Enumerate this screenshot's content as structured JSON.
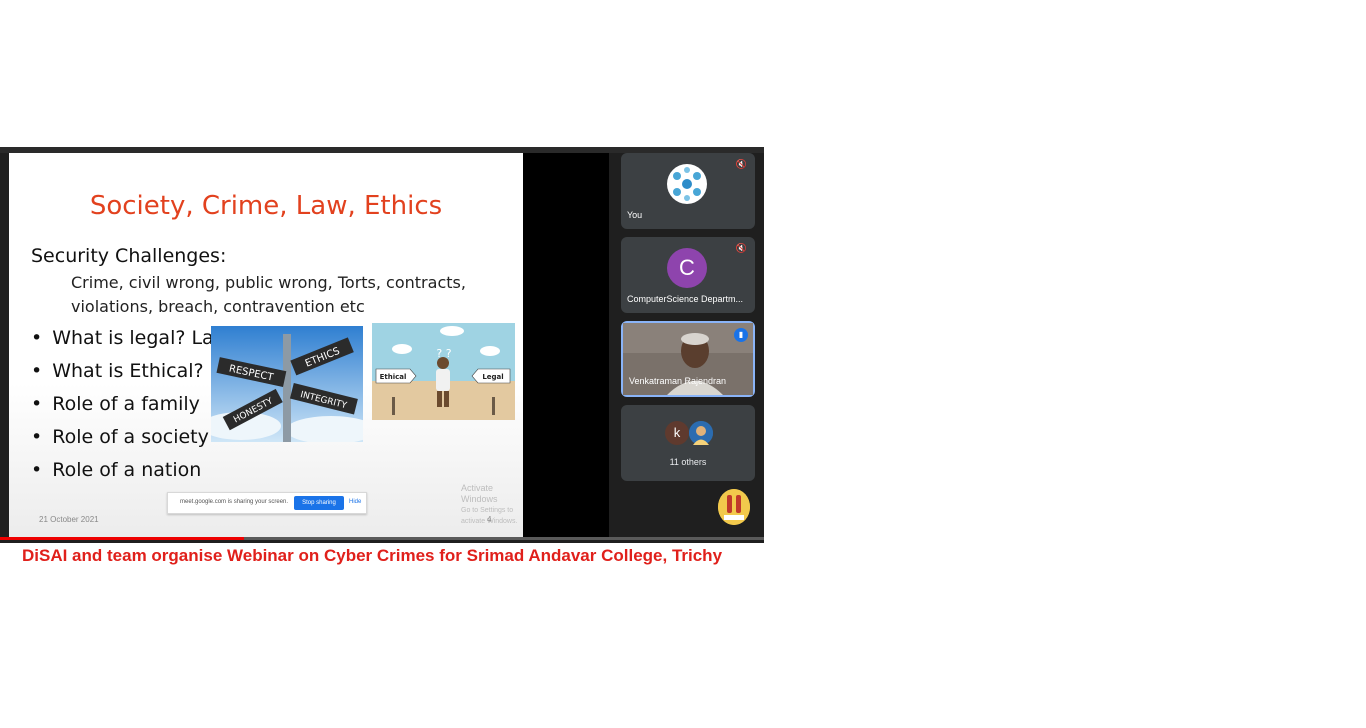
{
  "slide": {
    "title": "Society, Crime, Law, Ethics",
    "heading": "Security Challenges:",
    "subtext": "Crime, civil wrong, public wrong, Torts, contracts, violations, breach, contravention etc",
    "bullets": [
      "What is legal? Lawful?",
      "What is Ethical?",
      "Role of a family",
      "Role of a society",
      "Role of a nation"
    ],
    "signs": [
      "RESPECT",
      "ETHICS",
      "INTEGRITY",
      "HONESTY"
    ],
    "cartoon_labels": [
      "Ethical",
      "Legal"
    ],
    "date": "21 October 2021",
    "page_number": "4"
  },
  "share_bar": {
    "text": "meet.google.com is sharing your screen.",
    "stop_label": "Stop sharing",
    "hide_label": "Hide"
  },
  "watermark": {
    "line1": "Activate Windows",
    "line2": "Go to Settings to activate Windows."
  },
  "participants": [
    {
      "name": "You",
      "mic": "muted"
    },
    {
      "name": "ComputerScience Departm...",
      "initial": "C",
      "mic": "muted"
    },
    {
      "name": "Venkatraman Rajendran",
      "mic": "speaking"
    },
    {
      "initial": "k",
      "label": "11 others"
    }
  ],
  "video_progress": 0.32,
  "caption": "DiSAI and team organise Webinar on Cyber Crimes for Srimad Andavar College, Trichy",
  "colors": {
    "accent_red": "#e0201b",
    "title_orange": "#e2411e",
    "meet_blue": "#1a73e8",
    "tile_bg": "#3c4043"
  }
}
